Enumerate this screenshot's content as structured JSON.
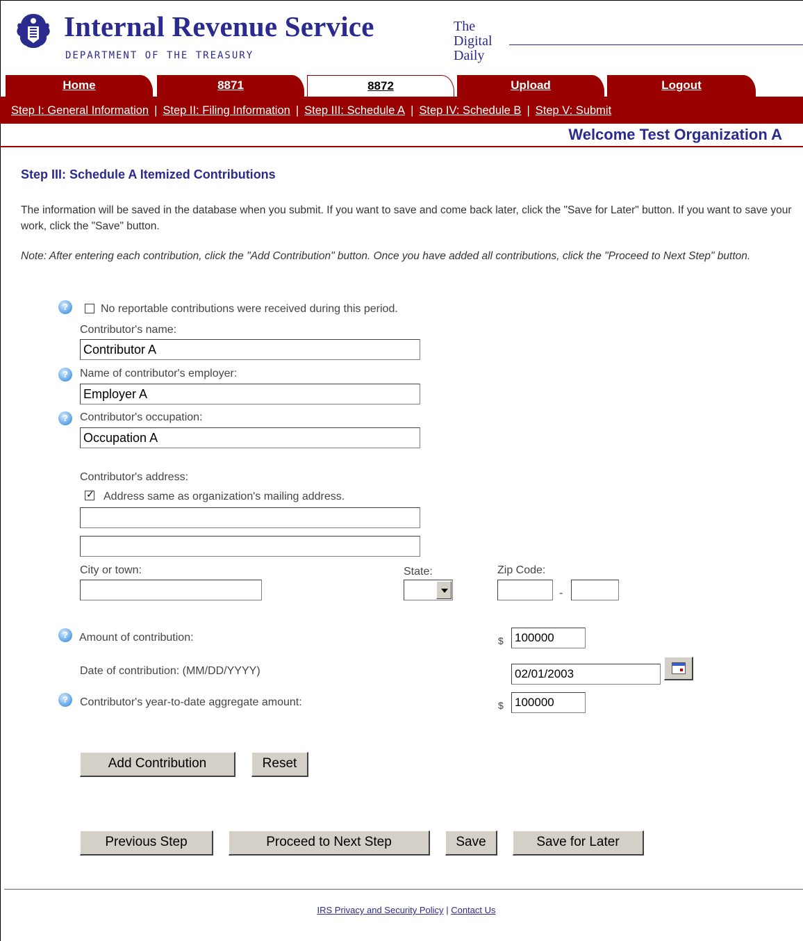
{
  "header": {
    "title": "Internal Revenue Service",
    "dept": "DEPARTMENT OF THE TREASURY",
    "digital_daily": [
      "The",
      "Digital",
      "Daily"
    ]
  },
  "tabs": [
    {
      "label": "Home",
      "active": false
    },
    {
      "label": "8871",
      "active": false
    },
    {
      "label": "8872",
      "active": true
    },
    {
      "label": "Upload",
      "active": false
    },
    {
      "label": "Logout",
      "active": false
    }
  ],
  "steps": [
    "Step I: General Information",
    "Step II: Filing Information",
    "Step III: Schedule A",
    "Step IV: Schedule B",
    "Step V: Submit"
  ],
  "welcome": "Welcome Test Organization A",
  "page_heading": "Step III: Schedule A Itemized Contributions",
  "info_text": "The information will be saved in the database when you submit. If you want to save and come back later, click the \"Save for Later\" button. If you want to save your work, click the \"Save\" button.",
  "note_text": "Note: After entering each contribution, click the \"Add Contribution\" button. Once you have added all contributions, click the \"Proceed to Next Step\" button.",
  "form": {
    "no_contributions_label": "No reportable contributions were received during this period.",
    "no_contributions_checked": false,
    "contributor_name_label": "Contributor's name:",
    "contributor_name_value": "Contributor A",
    "employer_label": "Name of contributor's employer:",
    "employer_value": "Employer A",
    "occupation_label": "Contributor's occupation:",
    "occupation_value": "Occupation A",
    "address_label": "Contributor's address:",
    "address_same_label": "Address same as organization's mailing address.",
    "address_same_checked": true,
    "address_line1": "",
    "address_line2": "",
    "city_label": "City or town:",
    "city_value": "",
    "state_label": "State:",
    "state_value": "",
    "zip_label": "Zip Code:",
    "zip_value": "",
    "zip_ext_value": "",
    "zip_dash": "-",
    "amount_label": "Amount of contribution:",
    "amount_value": "100000",
    "date_label": "Date of contribution: (MM/DD/YYYY)",
    "date_value": "02/01/2003",
    "ytd_label": "Contributor's year-to-date aggregate amount:",
    "ytd_value": "100000",
    "currency_symbol": "$"
  },
  "buttons": {
    "add_contribution": "Add Contribution",
    "reset": "Reset",
    "previous_step": "Previous Step",
    "proceed": "Proceed to Next Step",
    "save": "Save",
    "save_later": "Save for Later"
  },
  "footer": {
    "privacy": "IRS Privacy and Security Policy",
    "separator": "|",
    "contact": "Contact Us"
  },
  "colors": {
    "brand_blue": "#2b2b8f",
    "tab_red": "#990000",
    "help_icon_blue": "#5aa0e6",
    "button_gray": "#d4d0c8"
  },
  "icons": [
    "irs-eagle-logo-icon",
    "help-icon",
    "calendar-icon",
    "dropdown-arrow-icon",
    "checkbox-check-icon"
  ]
}
